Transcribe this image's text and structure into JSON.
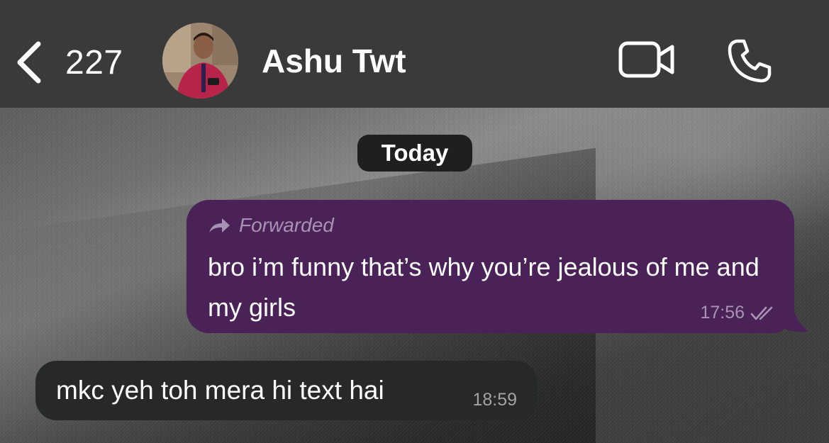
{
  "header": {
    "back_count": "227",
    "contact_name": "Ashu Twt",
    "avatar_icon": "contact-avatar-photo",
    "video_icon": "video-camera-icon",
    "call_icon": "phone-icon"
  },
  "chat": {
    "date_label": "Today",
    "messages": [
      {
        "direction": "outgoing",
        "forwarded_label": "Forwarded",
        "text": "bro i’m funny that’s why you’re jealous of me and my girls",
        "time": "17:56",
        "status": "read-double-check"
      },
      {
        "direction": "incoming",
        "text": "mkc yeh toh mera hi text hai",
        "time": "18:59"
      }
    ]
  },
  "colors": {
    "header_bg": "#3a3a3a",
    "outgoing_bubble": "#4a2258",
    "incoming_bubble": "#272828",
    "date_pill": "#1f1f1f"
  }
}
